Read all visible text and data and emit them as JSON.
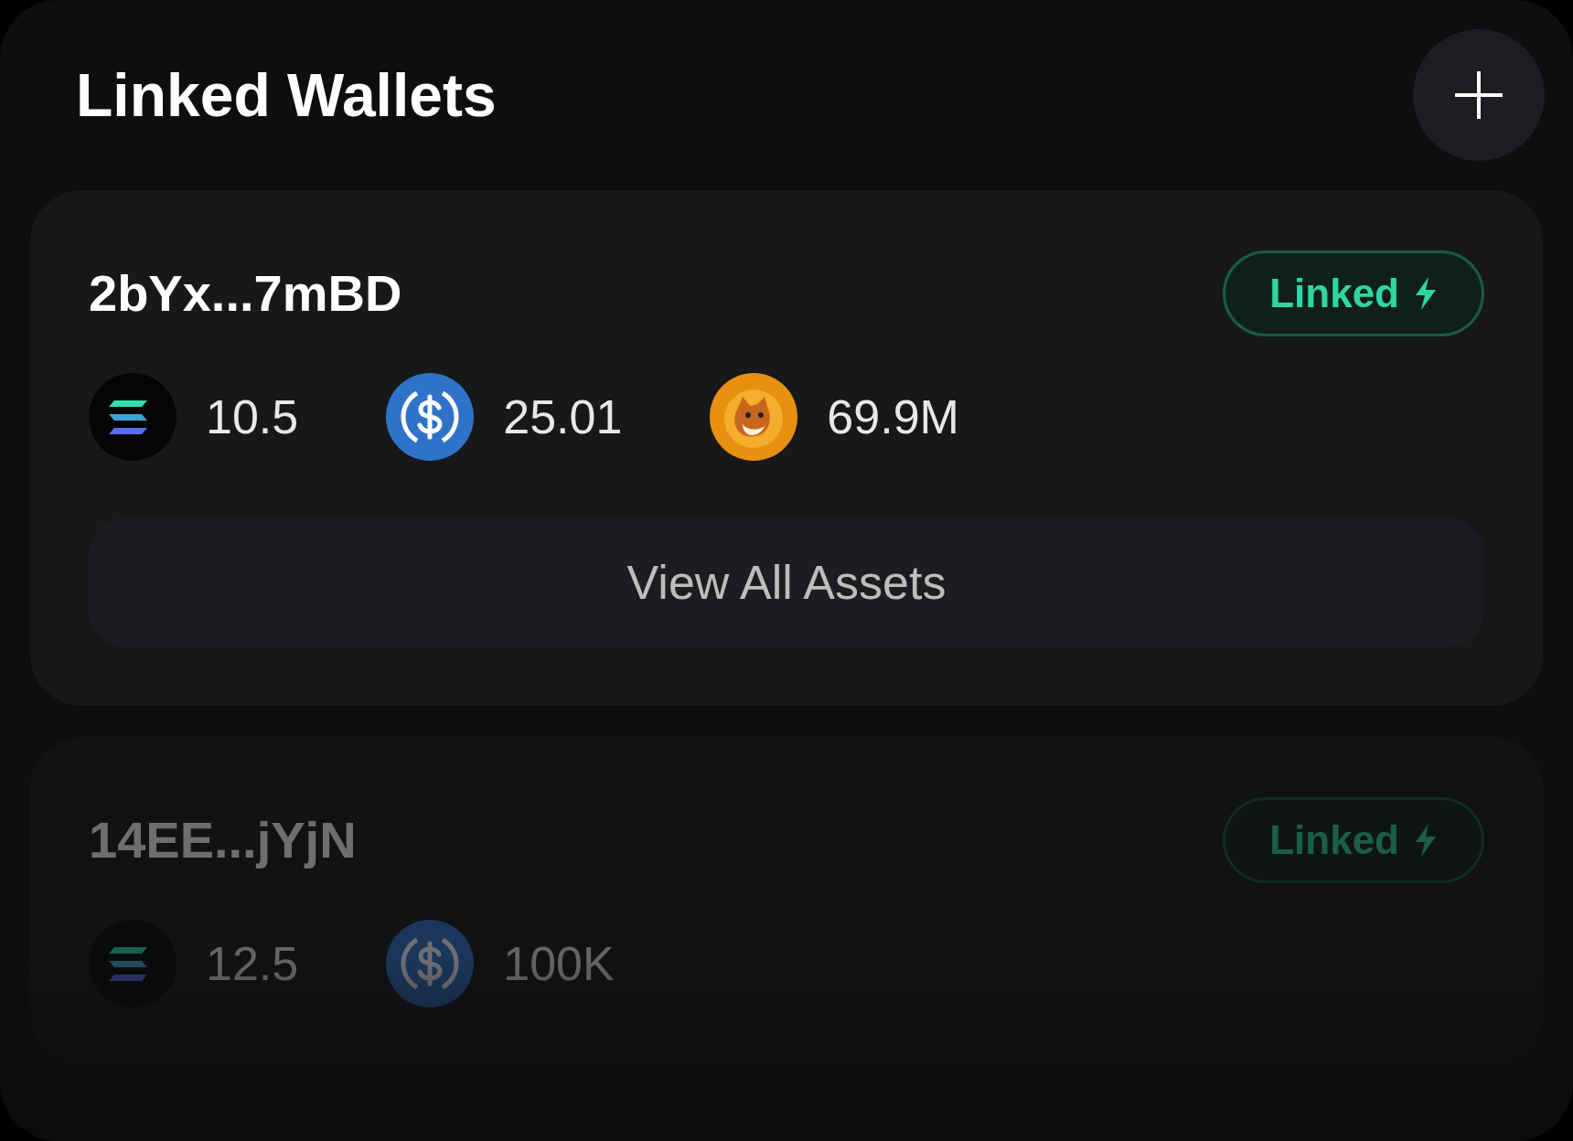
{
  "title": "Linked Wallets",
  "wallets": [
    {
      "address": "2bYx...7mBD",
      "dimmed": false,
      "status": "Linked",
      "tokens": [
        {
          "kind": "sol",
          "amount": "10.5"
        },
        {
          "kind": "usdc",
          "amount": "25.01"
        },
        {
          "kind": "dog",
          "amount": "69.9M"
        }
      ],
      "button": "View All Assets"
    },
    {
      "address": "14EE...jYjN",
      "dimmed": true,
      "status": "Linked",
      "tokens": [
        {
          "kind": "sol",
          "amount": "12.5"
        },
        {
          "kind": "usdc",
          "amount": "100K"
        }
      ]
    }
  ]
}
